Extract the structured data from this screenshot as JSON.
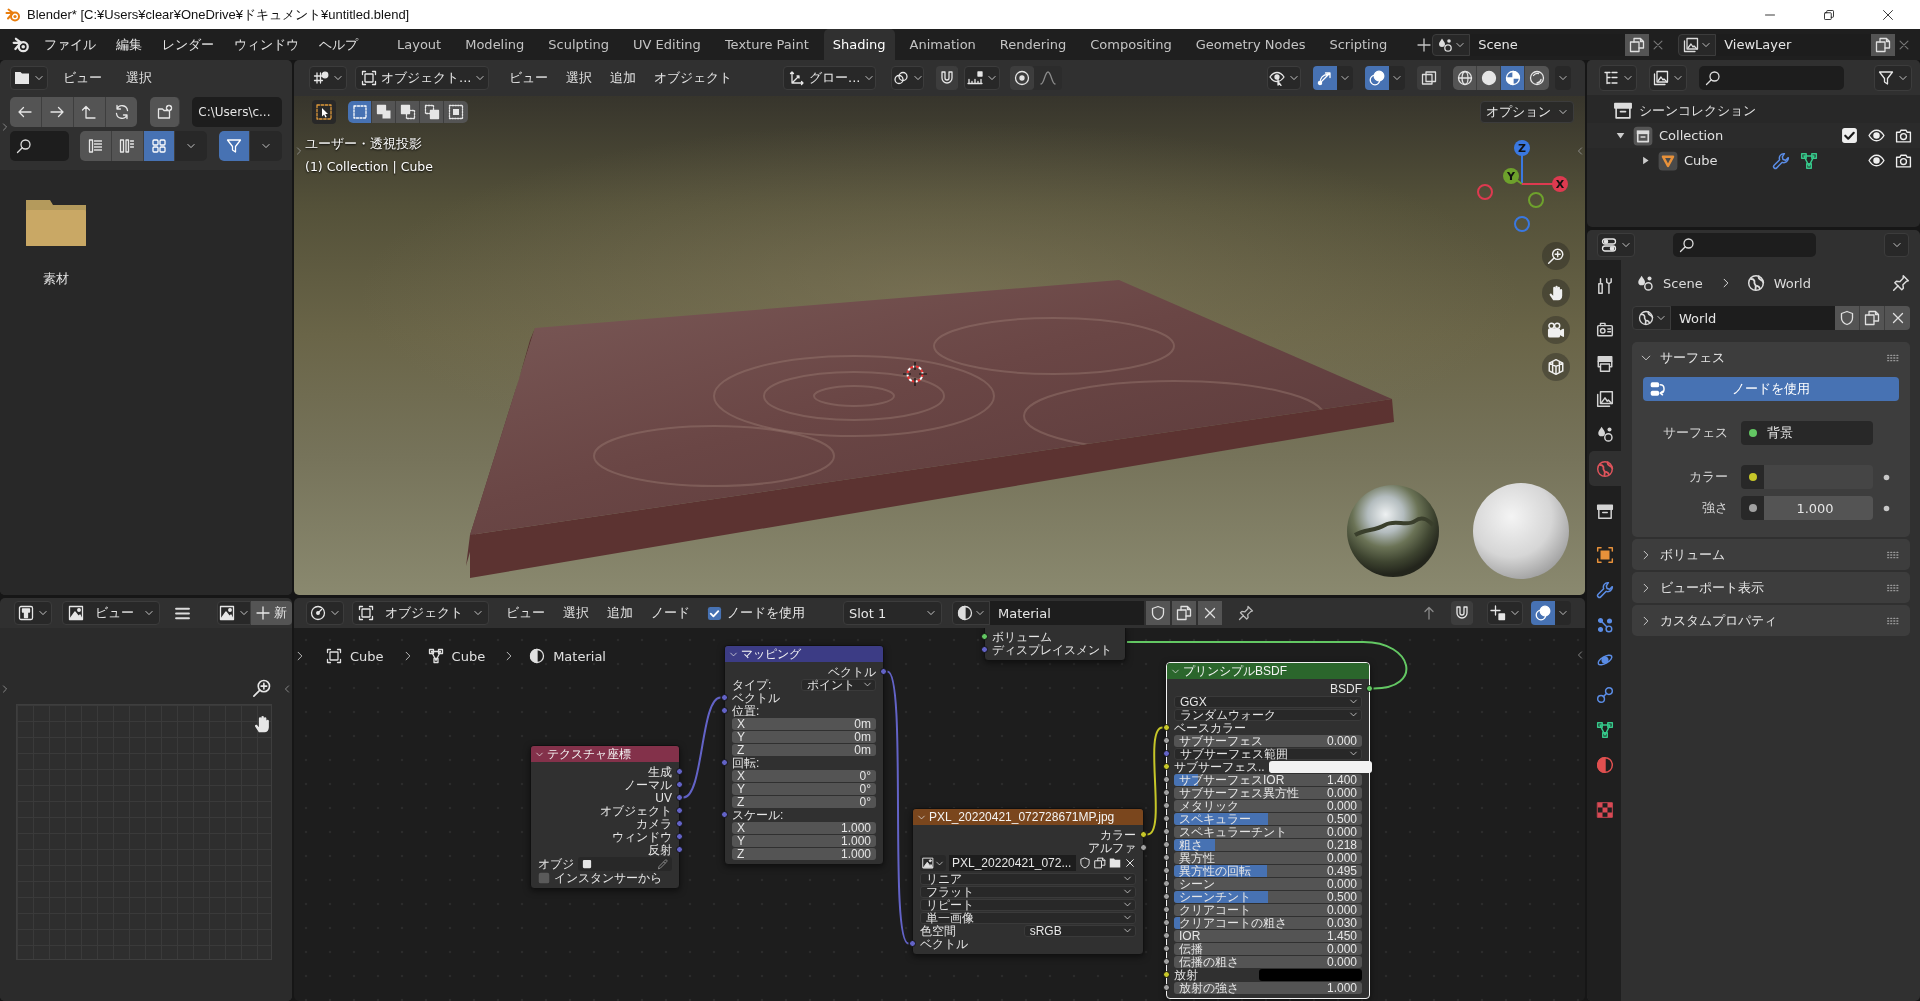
{
  "window": {
    "title": "Blender* [C:¥Users¥clear¥OneDrive¥ドキュメント¥untitled.blend]"
  },
  "top_bar": {
    "menus": [
      "ファイル",
      "編集",
      "レンダー",
      "ウィンドウ",
      "ヘルプ"
    ],
    "workspaces": [
      {
        "label": "Layout",
        "selected": false
      },
      {
        "label": "Modeling",
        "selected": false
      },
      {
        "label": "Sculpting",
        "selected": false
      },
      {
        "label": "UV Editing",
        "selected": false
      },
      {
        "label": "Texture Paint",
        "selected": false
      },
      {
        "label": "Shading",
        "selected": true
      },
      {
        "label": "Animation",
        "selected": false
      },
      {
        "label": "Rendering",
        "selected": false
      },
      {
        "label": "Compositing",
        "selected": false
      },
      {
        "label": "Geometry Nodes",
        "selected": false
      },
      {
        "label": "Scripting",
        "selected": false
      }
    ],
    "scene": "Scene",
    "view_layer": "ViewLayer"
  },
  "file_browser": {
    "menus": [
      "ビュー",
      "選択"
    ],
    "path": "C:\\Users\\c...",
    "display_modes": [
      {
        "kind": "list",
        "selected": false
      },
      {
        "kind": "columns",
        "selected": false
      },
      {
        "kind": "thumbnails",
        "selected": true
      }
    ],
    "filter": {
      "selected": true
    },
    "items": [
      {
        "name": "素材"
      }
    ]
  },
  "viewport": {
    "mode": "オブジェクト...",
    "menus": [
      "ビュー",
      "選択",
      "追加",
      "オブジェクト"
    ],
    "orientation": "グロー...",
    "toggles": [
      {
        "kind": "gizmo",
        "selected": true
      },
      {
        "kind": "overlay",
        "selected": true
      },
      {
        "kind": "xray",
        "selected": false
      }
    ],
    "shading": [
      {
        "kind": "wireframe",
        "selected": false
      },
      {
        "kind": "solid",
        "selected": false
      },
      {
        "kind": "material",
        "selected": true
      },
      {
        "kind": "rendered",
        "selected": false
      }
    ],
    "select_modes": [
      {
        "kind": "set",
        "selected": true
      },
      {
        "kind": "extend",
        "selected": false
      },
      {
        "kind": "subtract",
        "selected": false
      },
      {
        "kind": "invert",
        "selected": false
      },
      {
        "kind": "intersect",
        "selected": false
      }
    ],
    "options": "オプション",
    "view_name": "ユーザー・透視投影",
    "object_info": "(1) Collection | Cube",
    "gizmo": [
      {
        "label": "Z",
        "color": "#3a78e0"
      },
      {
        "label": "Y",
        "color": "#6ea12c"
      },
      {
        "label": "X",
        "color": "#dd3a50"
      }
    ]
  },
  "outliner": {
    "items": [
      {
        "name": "シーンコレクション",
        "kind": "scene-collection",
        "children": [
          {
            "name": "Collection",
            "kind": "collection",
            "expanded": true,
            "checked": true,
            "children": [
              {
                "name": "Cube",
                "kind": "mesh-object",
                "expanded": false
              }
            ]
          }
        ]
      }
    ]
  },
  "properties": {
    "tabs": [
      {
        "kind": "tool",
        "selected": false
      },
      {
        "kind": "render",
        "selected": false
      },
      {
        "kind": "output",
        "selected": false
      },
      {
        "kind": "view-layer",
        "selected": false
      },
      {
        "kind": "scene",
        "selected": false
      },
      {
        "kind": "world",
        "selected": true
      },
      {
        "kind": "collection",
        "selected": false
      },
      {
        "kind": "object",
        "selected": false
      },
      {
        "kind": "modifier",
        "selected": false
      },
      {
        "kind": "particles",
        "selected": false
      },
      {
        "kind": "physics",
        "selected": false
      },
      {
        "kind": "constraints",
        "selected": false
      },
      {
        "kind": "data",
        "selected": false
      },
      {
        "kind": "material",
        "selected": false
      },
      {
        "kind": "texture",
        "selected": false
      }
    ],
    "breadcrumb": [
      "Scene",
      "World"
    ],
    "world": "World",
    "panels": [
      {
        "title": "サーフェス",
        "expanded": true,
        "button": "ノードを使用",
        "rows": [
          {
            "kind": "link",
            "label": "サーフェス",
            "value": "背景",
            "color": "#63c763"
          },
          {
            "kind": "color",
            "label": "カラー",
            "color": "#c7c729"
          },
          {
            "kind": "number",
            "label": "強さ",
            "value": "1.000",
            "color": "#a1a1a1"
          }
        ]
      },
      {
        "title": "ボリューム",
        "expanded": false
      },
      {
        "title": "ビューポート表示",
        "expanded": false
      },
      {
        "title": "カスタムプロパティ",
        "expanded": false
      }
    ]
  },
  "image_editor": {
    "view_menu": "ビュー",
    "new_button": "新"
  },
  "node_editor": {
    "mode": "オブジェクト",
    "menus": [
      "ビュー",
      "選択",
      "追加",
      "ノード"
    ],
    "use_nodes": {
      "label": "ノードを使用",
      "checked": true
    },
    "slot": "Slot 1",
    "material": "Material",
    "breadcrumb": [
      {
        "kind": "object",
        "label": "Cube"
      },
      {
        "kind": "mesh",
        "label": "Cube"
      },
      {
        "kind": "material",
        "label": "Material"
      }
    ],
    "nodes": [
      {
        "kind": "output",
        "selected": false,
        "rows": [
          {
            "kind": "input",
            "label": "ボリューム",
            "socket": {
              "kind": "shader"
            }
          },
          {
            "kind": "input",
            "label": "ディスプレイスメント",
            "socket": {
              "kind": "vector"
            }
          }
        ]
      },
      {
        "kind": "mapping",
        "title": "マッピング",
        "color": "#3c3c85",
        "selected": false,
        "rows": [
          {
            "kind": "output",
            "label": "ベクトル",
            "socket": {
              "kind": "vector"
            }
          },
          {
            "kind": "dropdown",
            "label": "タイプ:",
            "value": "ポイント"
          },
          {
            "kind": "input",
            "label": "ベクトル",
            "socket": {
              "kind": "vector"
            }
          },
          {
            "kind": "heading",
            "label": "位置:",
            "socket": {
              "kind": "vector"
            }
          },
          {
            "kind": "field",
            "label": "X",
            "value": "0m"
          },
          {
            "kind": "field",
            "label": "Y",
            "value": "0m"
          },
          {
            "kind": "field",
            "label": "Z",
            "value": "0m"
          },
          {
            "kind": "heading",
            "label": "回転:",
            "socket": {
              "kind": "vector"
            }
          },
          {
            "kind": "field",
            "label": "X",
            "value": "0°"
          },
          {
            "kind": "field",
            "label": "Y",
            "value": "0°"
          },
          {
            "kind": "field",
            "label": "Z",
            "value": "0°"
          },
          {
            "kind": "heading",
            "label": "スケール:",
            "socket": {
              "kind": "vector"
            }
          },
          {
            "kind": "field",
            "label": "X",
            "value": "1.000"
          },
          {
            "kind": "field",
            "label": "Y",
            "value": "1.000"
          },
          {
            "kind": "field",
            "label": "Z",
            "value": "1.000"
          }
        ]
      },
      {
        "kind": "texcoord",
        "title": "テクスチャ座標",
        "color": "#83314a",
        "selected": false,
        "rows": [
          {
            "kind": "output",
            "label": "生成",
            "socket": {
              "kind": "vector"
            }
          },
          {
            "kind": "output",
            "label": "ノーマル",
            "socket": {
              "kind": "vector"
            }
          },
          {
            "kind": "output",
            "label": "UV",
            "socket": {
              "kind": "vector"
            }
          },
          {
            "kind": "output",
            "label": "オブジェクト",
            "socket": {
              "kind": "vector"
            }
          },
          {
            "kind": "output",
            "label": "カメラ",
            "socket": {
              "kind": "vector"
            }
          },
          {
            "kind": "output",
            "label": "ウィンドウ",
            "socket": {
              "kind": "vector"
            }
          },
          {
            "kind": "output",
            "label": "反射",
            "socket": {
              "kind": "vector"
            }
          },
          {
            "kind": "object",
            "label": "オブジ"
          },
          {
            "kind": "checkbox",
            "label": "インスタンサーから",
            "checked": false
          }
        ]
      },
      {
        "kind": "image",
        "title": "PXL_20220421_072728671MP.jpg",
        "color": "#7a461d",
        "selected": false,
        "rows": [
          {
            "kind": "output",
            "label": "カラー",
            "socket": {
              "kind": "color"
            }
          },
          {
            "kind": "output",
            "label": "アルファ",
            "socket": {
              "kind": "float"
            }
          },
          {
            "kind": "image",
            "value": "PXL_20220421_072..."
          },
          {
            "kind": "dropdown",
            "value": "リニア"
          },
          {
            "kind": "dropdown",
            "value": "フラット"
          },
          {
            "kind": "dropdown",
            "value": "リピート"
          },
          {
            "kind": "dropdown",
            "value": "単一画像"
          },
          {
            "kind": "dropdown",
            "label": "色空間",
            "value": "sRGB"
          },
          {
            "kind": "input",
            "label": "ベクトル",
            "socket": {
              "kind": "vector"
            }
          }
        ]
      },
      {
        "kind": "bsdf",
        "title": "プリンシプルBSDF",
        "color": "#2b662c",
        "selected": true,
        "rows": [
          {
            "kind": "output",
            "label": "BSDF",
            "socket": {
              "kind": "shader"
            }
          },
          {
            "kind": "dropdown",
            "value": "GGX"
          },
          {
            "kind": "dropdown",
            "value": "ランダムウォーク"
          },
          {
            "kind": "input",
            "label": "ベースカラー",
            "socket": {
              "kind": "color"
            }
          },
          {
            "kind": "slider",
            "label": "サブサーフェス",
            "value": "0.000",
            "level": 0,
            "socket": {
              "kind": "float"
            }
          },
          {
            "kind": "dropdown",
            "value": "サブサーフェス範囲",
            "socket": {
              "kind": "vector"
            }
          },
          {
            "kind": "color",
            "label": "サブサーフェス..",
            "color": "#f2f2f2",
            "socket": {
              "kind": "color"
            }
          },
          {
            "kind": "slider",
            "label": "サブサーフェスIOR",
            "value": "1.400",
            "level": 0.13,
            "socket": {
              "kind": "float"
            }
          },
          {
            "kind": "slider",
            "label": "サブサーフェス異方性",
            "value": "0.000",
            "level": 0,
            "socket": {
              "kind": "float"
            }
          },
          {
            "kind": "slider",
            "label": "メタリック",
            "value": "0.000",
            "level": 0,
            "socket": {
              "kind": "float"
            }
          },
          {
            "kind": "slider",
            "label": "スペキュラー",
            "value": "0.500",
            "level": 0.5,
            "socket": {
              "kind": "float"
            }
          },
          {
            "kind": "slider",
            "label": "スペキュラーチント",
            "value": "0.000",
            "level": 0,
            "socket": {
              "kind": "float"
            }
          },
          {
            "kind": "slider",
            "label": "粗さ",
            "value": "0.218",
            "level": 0.218,
            "socket": {
              "kind": "float"
            }
          },
          {
            "kind": "slider",
            "label": "異方性",
            "value": "0.000",
            "level": 0,
            "socket": {
              "kind": "float"
            }
          },
          {
            "kind": "slider",
            "label": "異方性の回転",
            "value": "0.495",
            "level": 0.495,
            "socket": {
              "kind": "float"
            }
          },
          {
            "kind": "slider",
            "label": "シーン",
            "value": "0.000",
            "level": 0,
            "socket": {
              "kind": "float"
            }
          },
          {
            "kind": "slider",
            "label": "シーンチント",
            "value": "0.500",
            "level": 0.5,
            "socket": {
              "kind": "float"
            }
          },
          {
            "kind": "slider",
            "label": "クリアコート",
            "value": "0.000",
            "level": 0,
            "socket": {
              "kind": "float"
            }
          },
          {
            "kind": "slider",
            "label": "クリアコートの粗さ",
            "value": "0.030",
            "level": 0.03,
            "socket": {
              "kind": "float"
            }
          },
          {
            "kind": "field",
            "label": "IOR",
            "value": "1.450",
            "socket": {
              "kind": "float"
            }
          },
          {
            "kind": "slider",
            "label": "伝播",
            "value": "0.000",
            "level": 0,
            "socket": {
              "kind": "float"
            }
          },
          {
            "kind": "slider",
            "label": "伝播の粗さ",
            "value": "0.000",
            "level": 0,
            "socket": {
              "kind": "float"
            }
          },
          {
            "kind": "color",
            "label": "放射",
            "color": "#000000",
            "socket": {
              "kind": "color"
            }
          },
          {
            "kind": "field",
            "label": "放射の強さ",
            "value": "1.000",
            "socket": {
              "kind": "float"
            }
          }
        ]
      }
    ]
  }
}
